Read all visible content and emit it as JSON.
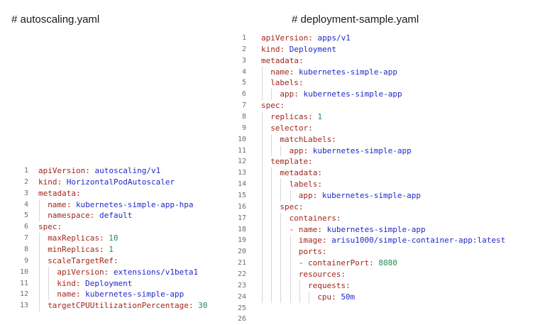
{
  "left_panel": {
    "title": "# autoscaling.yaml",
    "lines": [
      {
        "n": "1",
        "indent": 0,
        "key": "apiVersion",
        "value": "autoscaling/v1",
        "vtype": "val"
      },
      {
        "n": "2",
        "indent": 0,
        "key": "kind",
        "value": "HorizontalPodAutoscaler",
        "vtype": "val"
      },
      {
        "n": "3",
        "indent": 0,
        "key": "metadata",
        "value": "",
        "vtype": "val"
      },
      {
        "n": "4",
        "indent": 1,
        "key": "name",
        "value": "kubernetes-simple-app-hpa",
        "vtype": "val"
      },
      {
        "n": "5",
        "indent": 1,
        "key": "namespace",
        "value": "default",
        "vtype": "val"
      },
      {
        "n": "6",
        "indent": 0,
        "key": "spec",
        "value": "",
        "vtype": "val"
      },
      {
        "n": "7",
        "indent": 1,
        "key": "maxReplicas",
        "value": "10",
        "vtype": "num"
      },
      {
        "n": "8",
        "indent": 1,
        "key": "minReplicas",
        "value": "1",
        "vtype": "num"
      },
      {
        "n": "9",
        "indent": 1,
        "key": "scaleTargetRef",
        "value": "",
        "vtype": "val"
      },
      {
        "n": "10",
        "indent": 2,
        "key": "apiVersion",
        "value": "extensions/v1beta1",
        "vtype": "val"
      },
      {
        "n": "11",
        "indent": 2,
        "key": "kind",
        "value": "Deployment",
        "vtype": "val"
      },
      {
        "n": "12",
        "indent": 2,
        "key": "name",
        "value": "kubernetes-simple-app",
        "vtype": "val"
      },
      {
        "n": "13",
        "indent": 1,
        "key": "targetCPUUtilizationPercentage",
        "value": "30",
        "vtype": "num"
      }
    ]
  },
  "right_panel": {
    "title": "# deployment-sample.yaml",
    "lines": [
      {
        "n": "1",
        "indent": 0,
        "key": "apiVersion",
        "value": "apps/v1",
        "vtype": "val"
      },
      {
        "n": "2",
        "indent": 0,
        "key": "kind",
        "value": "Deployment",
        "vtype": "val"
      },
      {
        "n": "3",
        "indent": 0,
        "key": "metadata",
        "value": "",
        "vtype": "val"
      },
      {
        "n": "4",
        "indent": 1,
        "key": "name",
        "value": "kubernetes-simple-app",
        "vtype": "val"
      },
      {
        "n": "5",
        "indent": 1,
        "key": "labels",
        "value": "",
        "vtype": "val"
      },
      {
        "n": "6",
        "indent": 2,
        "key": "app",
        "value": "kubernetes-simple-app",
        "vtype": "val"
      },
      {
        "n": "7",
        "indent": 0,
        "key": "spec",
        "value": "",
        "vtype": "val"
      },
      {
        "n": "8",
        "indent": 1,
        "key": "replicas",
        "value": "1",
        "vtype": "num"
      },
      {
        "n": "9",
        "indent": 1,
        "key": "selector",
        "value": "",
        "vtype": "val"
      },
      {
        "n": "10",
        "indent": 2,
        "key": "matchLabels",
        "value": "",
        "vtype": "val"
      },
      {
        "n": "11",
        "indent": 3,
        "key": "app",
        "value": "kubernetes-simple-app",
        "vtype": "val"
      },
      {
        "n": "12",
        "indent": 1,
        "key": "template",
        "value": "",
        "vtype": "val"
      },
      {
        "n": "13",
        "indent": 2,
        "key": "metadata",
        "value": "",
        "vtype": "val"
      },
      {
        "n": "14",
        "indent": 3,
        "key": "labels",
        "value": "",
        "vtype": "val"
      },
      {
        "n": "15",
        "indent": 4,
        "key": "app",
        "value": "kubernetes-simple-app",
        "vtype": "val"
      },
      {
        "n": "16",
        "indent": 2,
        "key": "spec",
        "value": "",
        "vtype": "val"
      },
      {
        "n": "17",
        "indent": 3,
        "key": "containers",
        "value": "",
        "vtype": "val"
      },
      {
        "n": "18",
        "indent": 3,
        "dash": true,
        "key": "name",
        "value": "kubernetes-simple-app",
        "vtype": "val"
      },
      {
        "n": "19",
        "indent": 4,
        "key": "image",
        "value": "arisu1000/simple-container-app:latest",
        "vtype": "val"
      },
      {
        "n": "20",
        "indent": 4,
        "key": "ports",
        "value": "",
        "vtype": "val"
      },
      {
        "n": "21",
        "indent": 4,
        "dash": true,
        "key": "containerPort",
        "value": "8080",
        "vtype": "num"
      },
      {
        "n": "22",
        "indent": 4,
        "key": "resources",
        "value": "",
        "vtype": "val"
      },
      {
        "n": "23",
        "indent": 5,
        "key": "requests",
        "value": "",
        "vtype": "val"
      },
      {
        "n": "24",
        "indent": 6,
        "key": "cpu",
        "value": "50m",
        "vtype": "val"
      },
      {
        "n": "25",
        "indent": 0,
        "key": "",
        "value": "",
        "vtype": "val"
      },
      {
        "n": "26",
        "indent": 0,
        "key": "",
        "value": "",
        "vtype": "val"
      }
    ]
  }
}
